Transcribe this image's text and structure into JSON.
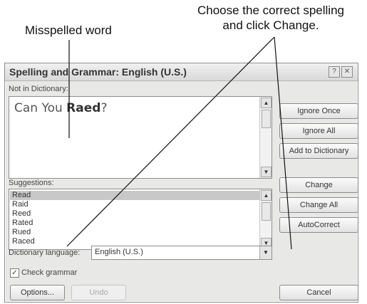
{
  "callouts": {
    "misspelled": "Misspelled word",
    "correct_line1": "Choose the correct spelling",
    "correct_line2": "and click Change."
  },
  "dialog": {
    "title": "Spelling and Grammar: English (U.S.)",
    "help_glyph": "?",
    "close_glyph": "✕",
    "not_in_dictionary_label": "Not in Dictionary:",
    "text_before": "Can You ",
    "text_misspelled": "Raed",
    "text_after": "?",
    "suggestions_label": "Suggestions:",
    "suggestions": [
      "Read",
      "Raid",
      "Reed",
      "Rated",
      "Rued",
      "Raced"
    ],
    "selected_suggestion": "Read",
    "dictionary_language_label": "Dictionary language:",
    "dictionary_language_value": "English (U.S.)",
    "check_grammar_label": "Check grammar",
    "check_grammar_checked": true,
    "buttons": {
      "ignore_once": "Ignore Once",
      "ignore_all": "Ignore All",
      "add_to_dictionary": "Add to Dictionary",
      "change": "Change",
      "change_all": "Change All",
      "autocorrect": "AutoCorrect",
      "options": "Options...",
      "undo": "Undo",
      "cancel": "Cancel"
    },
    "icons": {
      "scroll_up": "up-arrow-icon",
      "scroll_down": "down-arrow-icon",
      "combo_down": "chevron-down-icon",
      "check": "checkmark-icon"
    }
  }
}
